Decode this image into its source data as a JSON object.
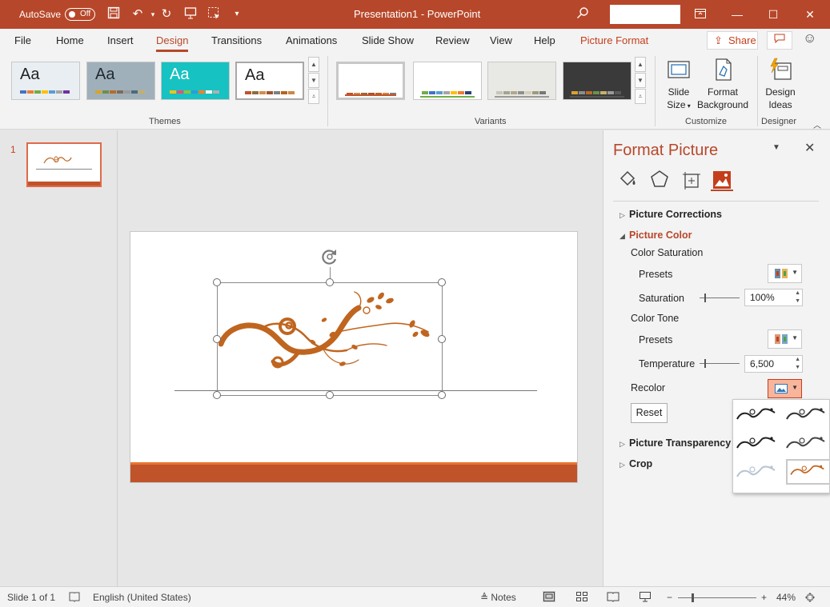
{
  "titlebar": {
    "autosave_label": "AutoSave",
    "autosave_state": "Off",
    "doc_title": "Presentation1  -  PowerPoint"
  },
  "tabs": [
    "File",
    "Home",
    "Insert",
    "Design",
    "Transitions",
    "Animations",
    "Slide Show",
    "Review",
    "View",
    "Help",
    "Picture Format"
  ],
  "active_tab": "Design",
  "share_label": "Share",
  "ribbon": {
    "themes": [
      {
        "aa": "Aa",
        "bg": "#e9eef2",
        "fg": "#222222",
        "swatches": [
          "#4472c4",
          "#ed7d31",
          "#70ad47",
          "#ffc000",
          "#5b9bd5",
          "#a5a5a5",
          "#7030a0"
        ]
      },
      {
        "aa": "Aa",
        "bg": "#9fb0ba",
        "fg": "#1f2a33",
        "swatches": [
          "#d8a32e",
          "#6e8f4f",
          "#b86b2b",
          "#7e6b58",
          "#9a9a9a",
          "#4d6a7a",
          "#c4b06a"
        ]
      },
      {
        "aa": "Aa",
        "bg": "#17c2c2",
        "fg": "#ffffff",
        "swatches": [
          "#f0c419",
          "#e94e77",
          "#8cc63f",
          "#2b9cd8",
          "#ff7f27",
          "#ffffff",
          "#b0b0b0"
        ]
      },
      {
        "aa": "Aa",
        "bg": "#ffffff",
        "fg": "#222222",
        "swatches": [
          "#c0532a",
          "#8c6d3f",
          "#d08e4c",
          "#a0522d",
          "#7f7f7f",
          "#b5651d",
          "#cc8844"
        ]
      }
    ],
    "variants": [
      {
        "bg": "#ffffff",
        "bar": "#c0532a",
        "swatches": [
          "#c0532a",
          "#d08e4c",
          "#8c6d3f",
          "#a0522d",
          "#b5651d",
          "#cc8844",
          "#7f7f7f"
        ]
      },
      {
        "bg": "#ffffff",
        "bar": "#70ad47",
        "swatches": [
          "#70ad47",
          "#4472c4",
          "#5b9bd5",
          "#a5a5a5",
          "#ffc000",
          "#ed7d31",
          "#264478"
        ]
      },
      {
        "bg": "#e8e8e4",
        "bar": "#9a9a9a",
        "swatches": [
          "#c8c6ba",
          "#a6a491",
          "#b0a98a",
          "#8f8f8f",
          "#d4cfb8",
          "#9e9a7c",
          "#777777"
        ]
      },
      {
        "bg": "#3a3a3a",
        "bar": "#555555",
        "swatches": [
          "#d8a32e",
          "#8c8c8c",
          "#b86b2b",
          "#6e8f4f",
          "#c4b06a",
          "#9a9a9a",
          "#5a5a5a"
        ]
      }
    ],
    "groups": {
      "themes": "Themes",
      "variants": "Variants",
      "customize": "Customize",
      "designer": "Designer"
    },
    "buttons": {
      "slide_size_1": "Slide",
      "slide_size_2": "Size",
      "format_bg_1": "Format",
      "format_bg_2": "Background",
      "design_ideas_1": "Design",
      "design_ideas_2": "Ideas"
    }
  },
  "slides": {
    "current_number": "1"
  },
  "panel": {
    "title": "Format Picture",
    "sections": {
      "corrections": "Picture Corrections",
      "color": "Picture Color",
      "transparency": "Picture Transparency",
      "crop": "Crop"
    },
    "color_saturation": "Color Saturation",
    "presets_label": "Presets",
    "saturation_label": "Saturation",
    "saturation_value": "100%",
    "color_tone": "Color Tone",
    "temperature_label": "Temperature",
    "temperature_value": "6,500",
    "recolor_label": "Recolor",
    "reset_label": "Reset"
  },
  "status": {
    "slide_info": "Slide 1 of 1",
    "language": "English (United States)",
    "notes": "Notes",
    "zoom_value": "44%",
    "zoom_level_percent": 44
  },
  "colors": {
    "accent": "#b7472a",
    "ornament": "#c0651f",
    "footer": "#c0532a"
  }
}
